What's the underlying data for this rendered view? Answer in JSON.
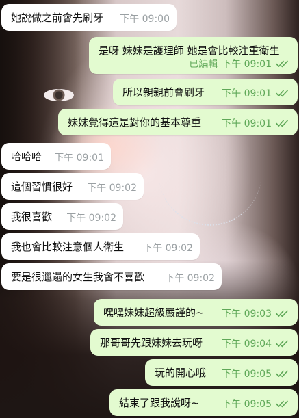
{
  "messages": [
    {
      "dir": "in",
      "text": "她說做之前會先刷牙",
      "time": "下午 09:00"
    },
    {
      "dir": "out",
      "text": "是呀 妹妹是護理師 她是會比較注重衛生",
      "time": "下午 09:01",
      "edited": "已編輯"
    },
    {
      "dir": "out",
      "text": "所以親親前會刷牙",
      "time": "下午 09:01"
    },
    {
      "dir": "out",
      "text": "妹妹覺得這是對你的基本尊重",
      "time": "下午 09:01"
    },
    {
      "dir": "in",
      "text": "哈哈哈",
      "time": "下午 09:01"
    },
    {
      "dir": "in",
      "text": "這個習慣很好",
      "time": "下午 09:02"
    },
    {
      "dir": "in",
      "text": "我很喜歡",
      "time": "下午 09:02"
    },
    {
      "dir": "in",
      "text": "我也會比較注意個人衛生",
      "time": "下午 09:02"
    },
    {
      "dir": "in",
      "text": "要是很邋遢的女生我會不喜歡",
      "time": "下午 09:02"
    },
    {
      "dir": "out",
      "text": "嘿嘿妹妹超級嚴謹的~",
      "time": "下午 09:03"
    },
    {
      "dir": "out",
      "text": "那哥哥先跟妹妹去玩呀",
      "time": "下午 09:04"
    },
    {
      "dir": "out",
      "text": "玩的開心哦",
      "time": "下午 09:05"
    },
    {
      "dir": "out",
      "text": "結束了跟我說呀~",
      "time": "下午 09:05"
    }
  ],
  "colors": {
    "incoming": "#ffffff",
    "outgoing": "#e3fbd0",
    "read_ticks": "#5fa858"
  },
  "icons": {
    "read_receipt": "double-check-icon"
  }
}
